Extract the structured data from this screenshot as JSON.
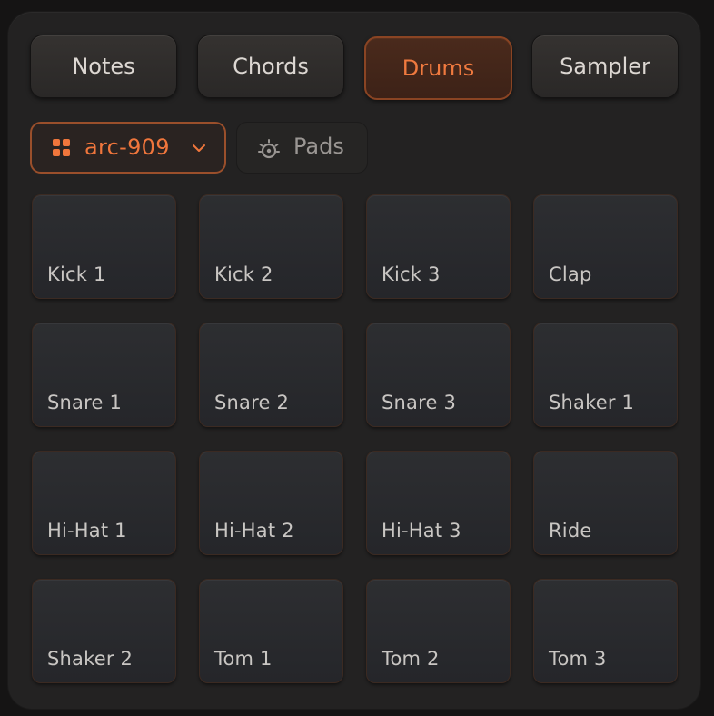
{
  "modes": [
    {
      "label": "Notes",
      "active": false
    },
    {
      "label": "Chords",
      "active": false
    },
    {
      "label": "Drums",
      "active": true
    },
    {
      "label": "Sampler",
      "active": false
    }
  ],
  "kit": {
    "label": "arc-909",
    "icon": "grid-icon"
  },
  "pads_toggle": {
    "label": "Pads",
    "icon": "pads-icon"
  },
  "pads": [
    {
      "label": "Kick 1"
    },
    {
      "label": "Kick 2"
    },
    {
      "label": "Kick 3"
    },
    {
      "label": "Clap"
    },
    {
      "label": "Snare 1"
    },
    {
      "label": "Snare 2"
    },
    {
      "label": "Snare 3"
    },
    {
      "label": "Shaker 1"
    },
    {
      "label": "Hi-Hat 1"
    },
    {
      "label": "Hi-Hat 2"
    },
    {
      "label": "Hi-Hat 3"
    },
    {
      "label": "Ride"
    },
    {
      "label": "Shaker 2"
    },
    {
      "label": "Tom 1"
    },
    {
      "label": "Tom 2"
    },
    {
      "label": "Tom 3"
    }
  ],
  "colors": {
    "accent": "#f0763c",
    "pad": "#2a2b2e",
    "background": "#232222"
  }
}
